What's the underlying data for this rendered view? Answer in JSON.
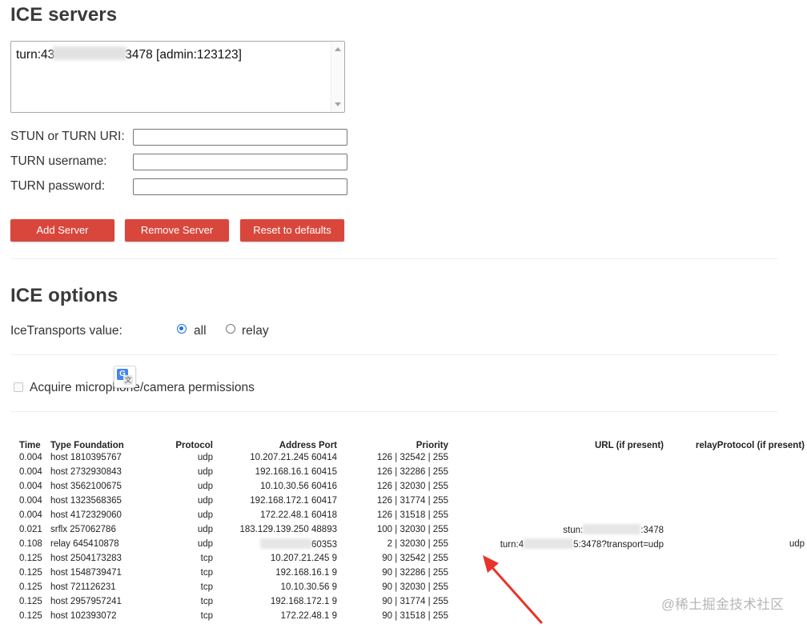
{
  "ice_servers": {
    "title": "ICE servers",
    "entry_prefix": "turn:43",
    "entry_suffix": "3478 [admin:123123]",
    "stun_label": "STUN or TURN URI:",
    "stun_value": "",
    "username_label": "TURN username:",
    "username_value": "",
    "password_label": "TURN password:",
    "password_value": "",
    "add_button": "Add Server",
    "remove_button": "Remove Server",
    "reset_button": "Reset to defaults"
  },
  "ice_options": {
    "title": "ICE options",
    "transports_label": "IceTransports value:",
    "opt_all": "all",
    "opt_relay": "relay",
    "selected": "all",
    "acquire_label": "Acquire microphone/camera permissions",
    "acquire_checked": false
  },
  "candidates": {
    "headers": [
      "Time",
      "Type Foundation",
      "Protocol",
      "Address Port",
      "Priority",
      "URL (if present)",
      "relayProtocol (if present)"
    ],
    "rows": [
      {
        "time": "0.004",
        "type": "host 1810395767",
        "protocol": "udp",
        "address": "10.207.21.245 60414",
        "priority": "126 | 32542 | 255",
        "url": "",
        "relay": ""
      },
      {
        "time": "0.004",
        "type": "host 2732930843",
        "protocol": "udp",
        "address": "192.168.16.1 60415",
        "priority": "126 | 32286 | 255",
        "url": "",
        "relay": ""
      },
      {
        "time": "0.004",
        "type": "host 3562100675",
        "protocol": "udp",
        "address": "10.10.30.56 60416",
        "priority": "126 | 32030 | 255",
        "url": "",
        "relay": ""
      },
      {
        "time": "0.004",
        "type": "host 1323568365",
        "protocol": "udp",
        "address": "192.168.172.1 60417",
        "priority": "126 | 31774 | 255",
        "url": "",
        "relay": ""
      },
      {
        "time": "0.004",
        "type": "host 4172329060",
        "protocol": "udp",
        "address": "172.22.48.1 60418",
        "priority": "126 | 31518 | 255",
        "url": "",
        "relay": ""
      },
      {
        "time": "0.021",
        "type": "srflx 257062786",
        "protocol": "udp",
        "address": "183.129.139.250 48893",
        "priority": "100 | 32030 | 255",
        "url_prefix": "stun:",
        "url_suffix": ":3478",
        "relay": ""
      },
      {
        "time": "0.108",
        "type": "relay 645410878",
        "protocol": "udp",
        "address_suffix": "60353",
        "priority": "2 | 32030 | 255",
        "url_prefix": "turn:4",
        "url_suffix": "5:3478?transport=udp",
        "relay": "udp"
      },
      {
        "time": "0.125",
        "type": "host 2504173283",
        "protocol": "tcp",
        "address": "10.207.21.245 9",
        "priority": "90 | 32542 | 255",
        "url": "",
        "relay": ""
      },
      {
        "time": "0.125",
        "type": "host 1548739471",
        "protocol": "tcp",
        "address": "192.168.16.1 9",
        "priority": "90 | 32286 | 255",
        "url": "",
        "relay": ""
      },
      {
        "time": "0.125",
        "type": "host 721126231",
        "protocol": "tcp",
        "address": "10.10.30.56 9",
        "priority": "90 | 32030 | 255",
        "url": "",
        "relay": ""
      },
      {
        "time": "0.125",
        "type": "host 2957957241",
        "protocol": "tcp",
        "address": "192.168.172.1 9",
        "priority": "90 | 31774 | 255",
        "url": "",
        "relay": ""
      },
      {
        "time": "0.125",
        "type": "host 102393072",
        "protocol": "tcp",
        "address": "172.22.48.1 9",
        "priority": "90 | 31518 | 255",
        "url": "",
        "relay": ""
      }
    ]
  },
  "watermark": "@稀土掘金技术社区",
  "colors": {
    "button_red": "#d9473c",
    "radio_blue": "#1a73e8",
    "annotation_arrow": "#e8332a"
  },
  "icons": {
    "translate": "google-translate-icon",
    "arrow": "red-annotation-arrow"
  }
}
